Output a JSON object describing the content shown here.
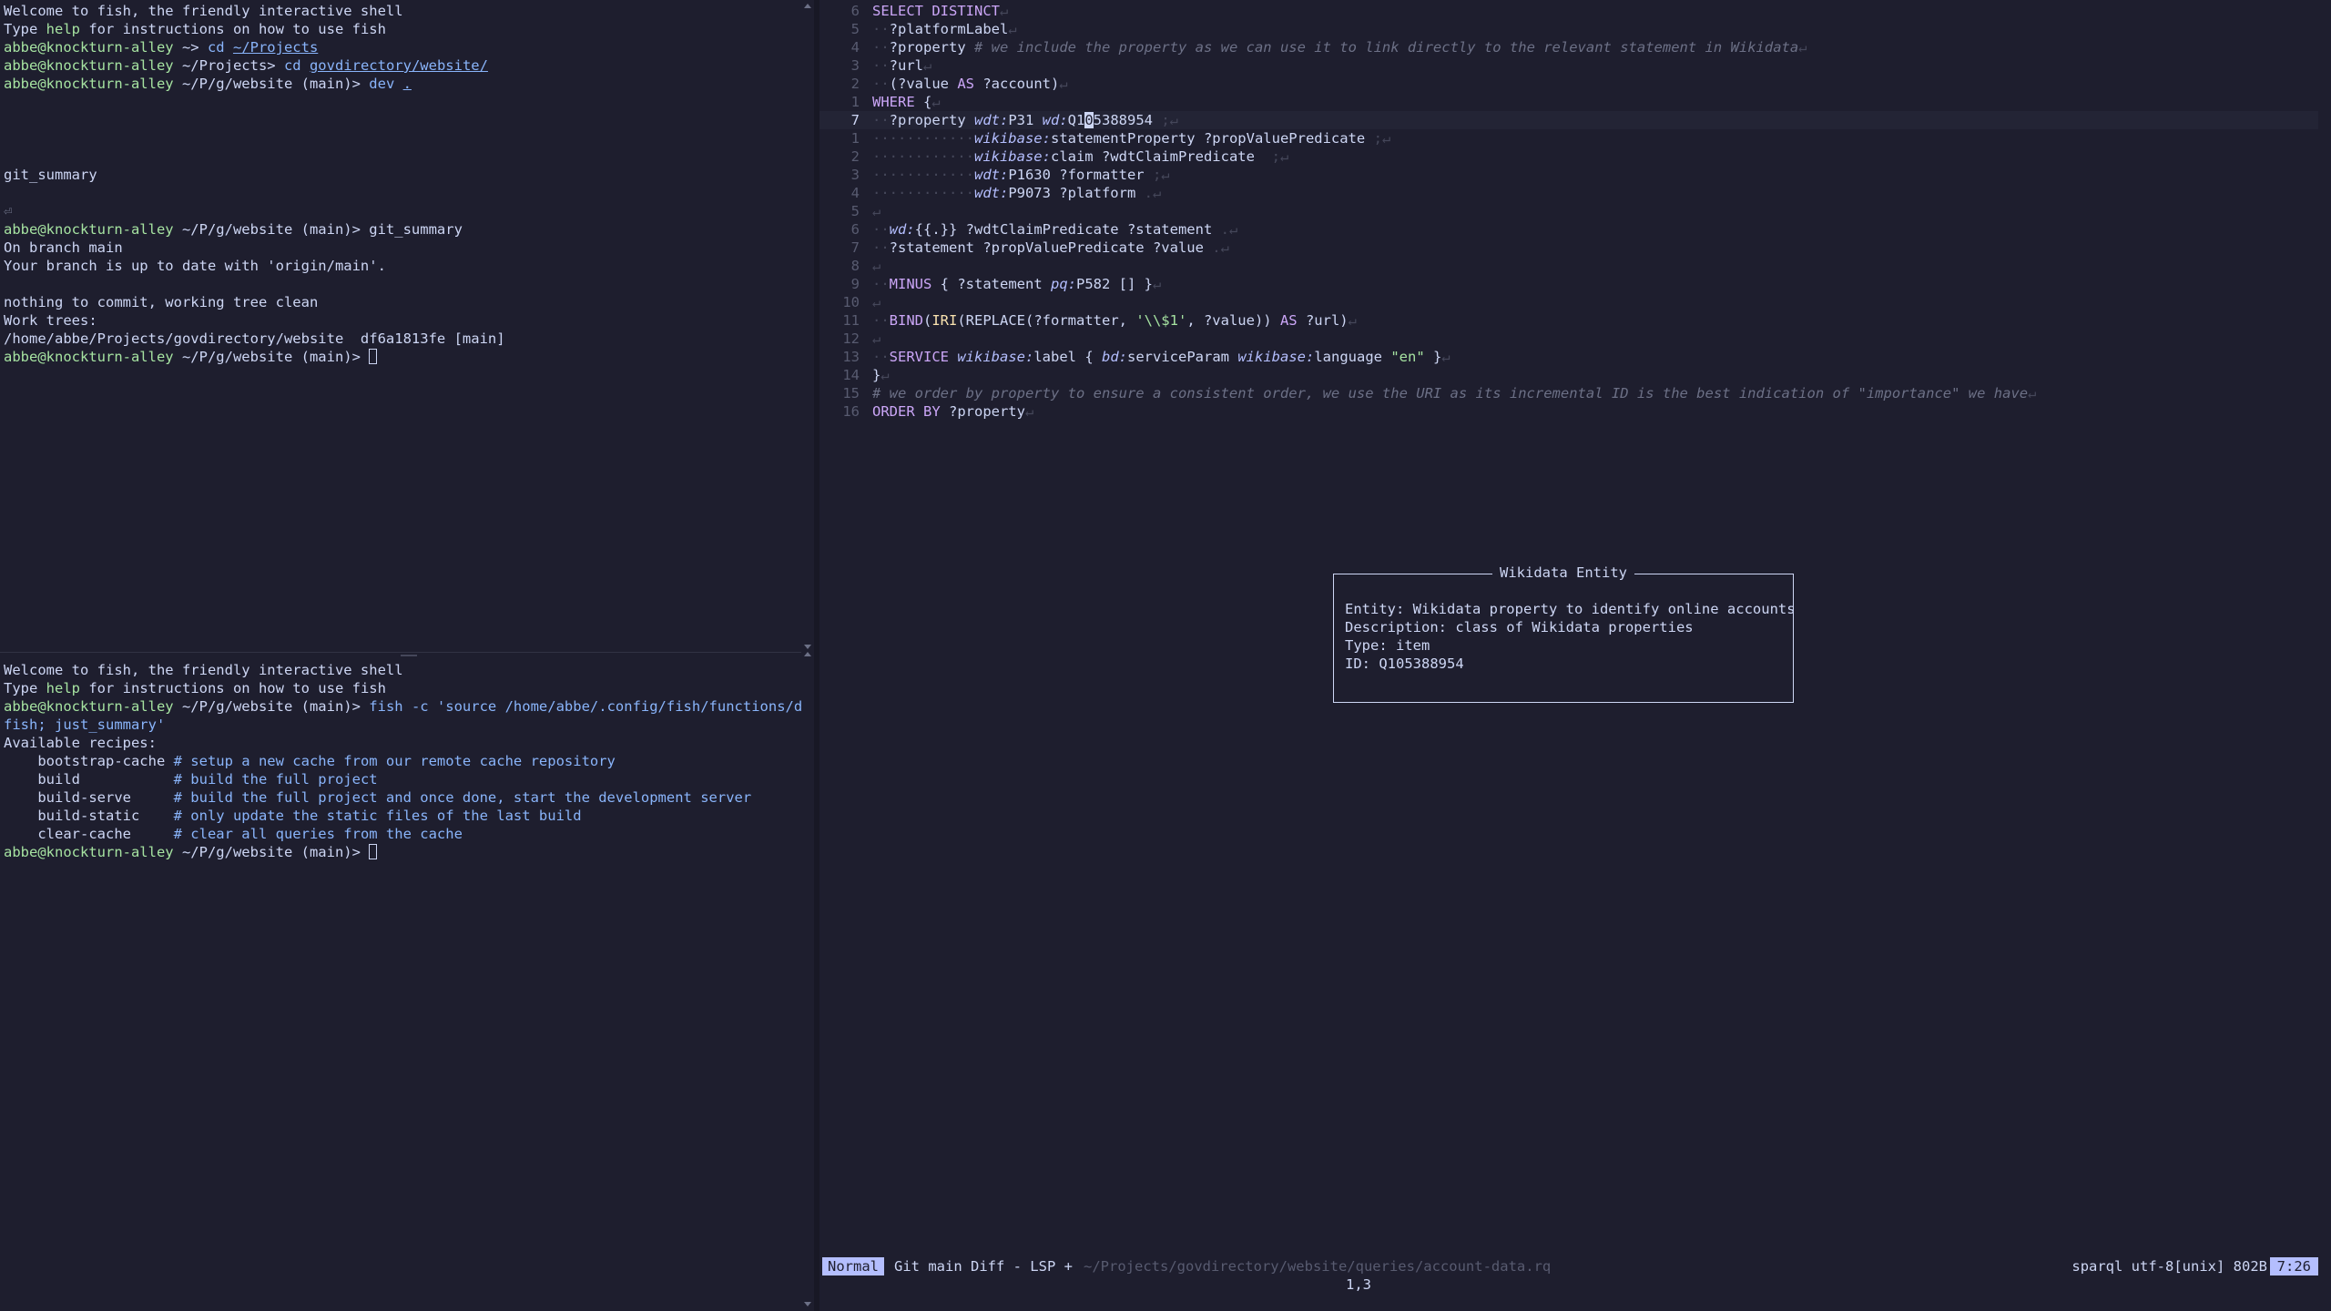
{
  "terminal_top": {
    "lines": [
      {
        "segs": [
          {
            "t": "Welcome to fish, the friendly interactive shell",
            "c": ""
          }
        ]
      },
      {
        "segs": [
          {
            "t": "Type ",
            "c": ""
          },
          {
            "t": "help",
            "c": "green"
          },
          {
            "t": " for instructions on how to use fish",
            "c": ""
          }
        ]
      },
      {
        "segs": [
          {
            "t": "abbe@knockturn-alley",
            "c": "green"
          },
          {
            "t": " ~> ",
            "c": ""
          },
          {
            "t": "cd ",
            "c": "blue"
          },
          {
            "t": "~/Projects",
            "c": "blue ul"
          }
        ]
      },
      {
        "segs": [
          {
            "t": "abbe@knockturn-alley",
            "c": "green"
          },
          {
            "t": " ~/Projects> ",
            "c": ""
          },
          {
            "t": "cd ",
            "c": "blue"
          },
          {
            "t": "govdirectory/website/",
            "c": "blue ul"
          }
        ]
      },
      {
        "segs": [
          {
            "t": "abbe@knockturn-alley",
            "c": "green"
          },
          {
            "t": " ~/P/g/website (main)> ",
            "c": ""
          },
          {
            "t": "dev ",
            "c": "blue"
          },
          {
            "t": ".",
            "c": "blue ul"
          }
        ]
      },
      {
        "segs": []
      },
      {
        "segs": []
      },
      {
        "segs": []
      },
      {
        "segs": []
      },
      {
        "segs": [
          {
            "t": "git_summary",
            "c": ""
          }
        ]
      },
      {
        "segs": []
      },
      {
        "segs": [
          {
            "t": "⏎",
            "c": "dim"
          }
        ]
      },
      {
        "segs": [
          {
            "t": "abbe@knockturn-alley",
            "c": "green"
          },
          {
            "t": " ~/P/g/website (main)> git_summary",
            "c": ""
          }
        ]
      },
      {
        "segs": [
          {
            "t": "On branch main",
            "c": ""
          }
        ]
      },
      {
        "segs": [
          {
            "t": "Your branch is up to date with 'origin/main'.",
            "c": ""
          }
        ]
      },
      {
        "segs": []
      },
      {
        "segs": [
          {
            "t": "nothing to commit, working tree clean",
            "c": ""
          }
        ]
      },
      {
        "segs": [
          {
            "t": "Work trees:",
            "c": ""
          }
        ]
      },
      {
        "segs": [
          {
            "t": "/home/abbe/Projects/govdirectory/website  df6a1813fe [main]",
            "c": ""
          }
        ]
      },
      {
        "segs": [
          {
            "t": "abbe@knockturn-alley",
            "c": "green"
          },
          {
            "t": " ~/P/g/website (main)> ",
            "c": ""
          }
        ],
        "cursor": true
      }
    ]
  },
  "terminal_bottom": {
    "lines": [
      {
        "segs": [
          {
            "t": "Welcome to fish, the friendly interactive shell",
            "c": ""
          }
        ]
      },
      {
        "segs": [
          {
            "t": "Type ",
            "c": ""
          },
          {
            "t": "help",
            "c": "green"
          },
          {
            "t": " for instructions on how to use fish",
            "c": ""
          }
        ]
      },
      {
        "segs": [
          {
            "t": "abbe@knockturn-alley",
            "c": "green"
          },
          {
            "t": " ~/P/g/website (main)> ",
            "c": ""
          },
          {
            "t": "fish -c 'source /home/abbe/.config/fish/functions/dev.",
            "c": "blue"
          }
        ]
      },
      {
        "segs": [
          {
            "t": "fish; just_summary'",
            "c": "blue"
          }
        ]
      },
      {
        "segs": [
          {
            "t": "Available recipes:",
            "c": ""
          }
        ]
      },
      {
        "segs": [
          {
            "t": "    bootstrap-cache ",
            "c": ""
          },
          {
            "t": "# setup a new cache from our remote cache repository",
            "c": "blue"
          }
        ]
      },
      {
        "segs": [
          {
            "t": "    build           ",
            "c": ""
          },
          {
            "t": "# build the full project",
            "c": "blue"
          }
        ]
      },
      {
        "segs": [
          {
            "t": "    build-serve     ",
            "c": ""
          },
          {
            "t": "# build the full project and once done, start the development server",
            "c": "blue"
          }
        ]
      },
      {
        "segs": [
          {
            "t": "    build-static    ",
            "c": ""
          },
          {
            "t": "# only update the static files of the last build",
            "c": "blue"
          }
        ]
      },
      {
        "segs": [
          {
            "t": "    clear-cache     ",
            "c": ""
          },
          {
            "t": "# clear all queries from the cache",
            "c": "blue"
          }
        ]
      },
      {
        "segs": [
          {
            "t": "abbe@knockturn-alley",
            "c": "green"
          },
          {
            "t": " ~/P/g/website (main)> ",
            "c": ""
          }
        ],
        "cursor": true
      }
    ]
  },
  "editor": {
    "lines": [
      {
        "n": "6",
        "segs": [
          {
            "t": "SELECT DISTINCT",
            "c": "kw"
          },
          {
            "t": "↵",
            "c": "ws"
          }
        ]
      },
      {
        "n": "5",
        "segs": [
          {
            "t": "··",
            "c": "ws"
          },
          {
            "t": "?platformLabel",
            "c": "var"
          },
          {
            "t": "↵",
            "c": "ws"
          }
        ]
      },
      {
        "n": "4",
        "segs": [
          {
            "t": "··",
            "c": "ws"
          },
          {
            "t": "?property ",
            "c": "var"
          },
          {
            "t": "# we include the property as we can use it to link directly to the relevant statement in Wikidata",
            "c": "cm"
          },
          {
            "t": "↵",
            "c": "ws"
          }
        ]
      },
      {
        "n": "3",
        "segs": [
          {
            "t": "··",
            "c": "ws"
          },
          {
            "t": "?url",
            "c": "var"
          },
          {
            "t": "↵",
            "c": "ws"
          }
        ]
      },
      {
        "n": "2",
        "segs": [
          {
            "t": "··",
            "c": "ws"
          },
          {
            "t": "(?value ",
            "c": "var"
          },
          {
            "t": "AS",
            "c": "kw"
          },
          {
            "t": " ?account)",
            "c": "var"
          },
          {
            "t": "↵",
            "c": "ws"
          }
        ]
      },
      {
        "n": "1",
        "segs": [
          {
            "t": "WHERE",
            "c": "kw"
          },
          {
            "t": " {",
            "c": "var"
          },
          {
            "t": "↵",
            "c": "ws"
          }
        ]
      },
      {
        "n": "7",
        "cur": true,
        "segs": [
          {
            "t": "··",
            "c": "ws"
          },
          {
            "t": "?property ",
            "c": "var"
          },
          {
            "t": "wdt:",
            "c": "pfx"
          },
          {
            "t": "P31 ",
            "c": "var"
          },
          {
            "t": "wd:",
            "c": "pfx"
          },
          {
            "t": "Q1",
            "c": "var"
          },
          {
            "t": "0",
            "c": "cursor-char"
          },
          {
            "t": "5388954 ",
            "c": "var"
          },
          {
            "t": ";",
            "c": "ws"
          },
          {
            "t": "↵",
            "c": "ws"
          }
        ]
      },
      {
        "n": "1",
        "segs": [
          {
            "t": "············",
            "c": "ws"
          },
          {
            "t": "wikibase:",
            "c": "pfx"
          },
          {
            "t": "statementProperty ?propValuePredicate ",
            "c": "var"
          },
          {
            "t": ";",
            "c": "ws"
          },
          {
            "t": "↵",
            "c": "ws"
          }
        ]
      },
      {
        "n": "2",
        "segs": [
          {
            "t": "············",
            "c": "ws"
          },
          {
            "t": "wikibase:",
            "c": "pfx"
          },
          {
            "t": "claim ?wdtClaimPredicate  ",
            "c": "var"
          },
          {
            "t": ";",
            "c": "ws"
          },
          {
            "t": "↵",
            "c": "ws"
          }
        ]
      },
      {
        "n": "3",
        "segs": [
          {
            "t": "············",
            "c": "ws"
          },
          {
            "t": "wdt:",
            "c": "pfx"
          },
          {
            "t": "P1630 ?formatter ",
            "c": "var"
          },
          {
            "t": ";",
            "c": "ws"
          },
          {
            "t": "↵",
            "c": "ws"
          }
        ]
      },
      {
        "n": "4",
        "segs": [
          {
            "t": "············",
            "c": "ws"
          },
          {
            "t": "wdt:",
            "c": "pfx"
          },
          {
            "t": "P9073 ?platform ",
            "c": "var"
          },
          {
            "t": ".",
            "c": "ws"
          },
          {
            "t": "↵",
            "c": "ws"
          }
        ]
      },
      {
        "n": "5",
        "segs": [
          {
            "t": "↵",
            "c": "ws"
          }
        ]
      },
      {
        "n": "6",
        "segs": [
          {
            "t": "··",
            "c": "ws"
          },
          {
            "t": "wd:",
            "c": "pfx"
          },
          {
            "t": "{{.}} ?wdtClaimPredicate ?statement ",
            "c": "var"
          },
          {
            "t": ".",
            "c": "ws"
          },
          {
            "t": "↵",
            "c": "ws"
          }
        ]
      },
      {
        "n": "7",
        "segs": [
          {
            "t": "··",
            "c": "ws"
          },
          {
            "t": "?statement ?propValuePredicate ?value ",
            "c": "var"
          },
          {
            "t": ".",
            "c": "ws"
          },
          {
            "t": "↵",
            "c": "ws"
          }
        ]
      },
      {
        "n": "8",
        "segs": [
          {
            "t": "↵",
            "c": "ws"
          }
        ]
      },
      {
        "n": "9",
        "segs": [
          {
            "t": "··",
            "c": "ws"
          },
          {
            "t": "MINUS",
            "c": "kw"
          },
          {
            "t": " { ?statement ",
            "c": "var"
          },
          {
            "t": "pq:",
            "c": "pfx"
          },
          {
            "t": "P582 [] }",
            "c": "var"
          },
          {
            "t": "↵",
            "c": "ws"
          }
        ]
      },
      {
        "n": "10",
        "segs": [
          {
            "t": "↵",
            "c": "ws"
          }
        ]
      },
      {
        "n": "11",
        "segs": [
          {
            "t": "··",
            "c": "ws"
          },
          {
            "t": "BIND",
            "c": "kw"
          },
          {
            "t": "(",
            "c": "var"
          },
          {
            "t": "IRI",
            "c": "fn"
          },
          {
            "t": "(REPLACE(?formatter, ",
            "c": "var"
          },
          {
            "t": "'\\\\$1'",
            "c": "str"
          },
          {
            "t": ", ?value)) ",
            "c": "var"
          },
          {
            "t": "AS",
            "c": "kw"
          },
          {
            "t": " ?url)",
            "c": "var"
          },
          {
            "t": "↵",
            "c": "ws"
          }
        ]
      },
      {
        "n": "12",
        "segs": [
          {
            "t": "↵",
            "c": "ws"
          }
        ]
      },
      {
        "n": "13",
        "segs": [
          {
            "t": "··",
            "c": "ws"
          },
          {
            "t": "SERVICE",
            "c": "kw"
          },
          {
            "t": " ",
            "c": "var"
          },
          {
            "t": "wikibase:",
            "c": "pfx"
          },
          {
            "t": "label { ",
            "c": "var"
          },
          {
            "t": "bd:",
            "c": "pfx"
          },
          {
            "t": "serviceParam ",
            "c": "var"
          },
          {
            "t": "wikibase:",
            "c": "pfx"
          },
          {
            "t": "language ",
            "c": "var"
          },
          {
            "t": "\"en\"",
            "c": "str"
          },
          {
            "t": " }",
            "c": "var"
          },
          {
            "t": "↵",
            "c": "ws"
          }
        ]
      },
      {
        "n": "14",
        "segs": [
          {
            "t": "}",
            "c": "var"
          },
          {
            "t": "↵",
            "c": "ws"
          }
        ]
      },
      {
        "n": "15",
        "segs": [
          {
            "t": "# we order by property to ensure a consistent order, we use the URI as its incremental ID is the best indication of \"importance\" we have",
            "c": "cm"
          },
          {
            "t": "↵",
            "c": "ws"
          }
        ]
      },
      {
        "n": "16",
        "segs": [
          {
            "t": "ORDER BY",
            "c": "kw"
          },
          {
            "t": " ?property",
            "c": "var"
          },
          {
            "t": "↵",
            "c": "ws"
          }
        ]
      }
    ]
  },
  "popup": {
    "title": "Wikidata Entity",
    "lines": [
      "Entity: Wikidata property to identify online accounts",
      "Description: class of Wikidata properties",
      "Type: item",
      "ID: Q105388954"
    ]
  },
  "statusbar": {
    "mode": "Normal",
    "git": "Git main Diff - LSP +",
    "path": "~/Projects/govdirectory/website/queries/account-data.rq",
    "fileinfo": "sparql utf-8[unix] 802B",
    "time": "7:26",
    "position": "1,3"
  }
}
